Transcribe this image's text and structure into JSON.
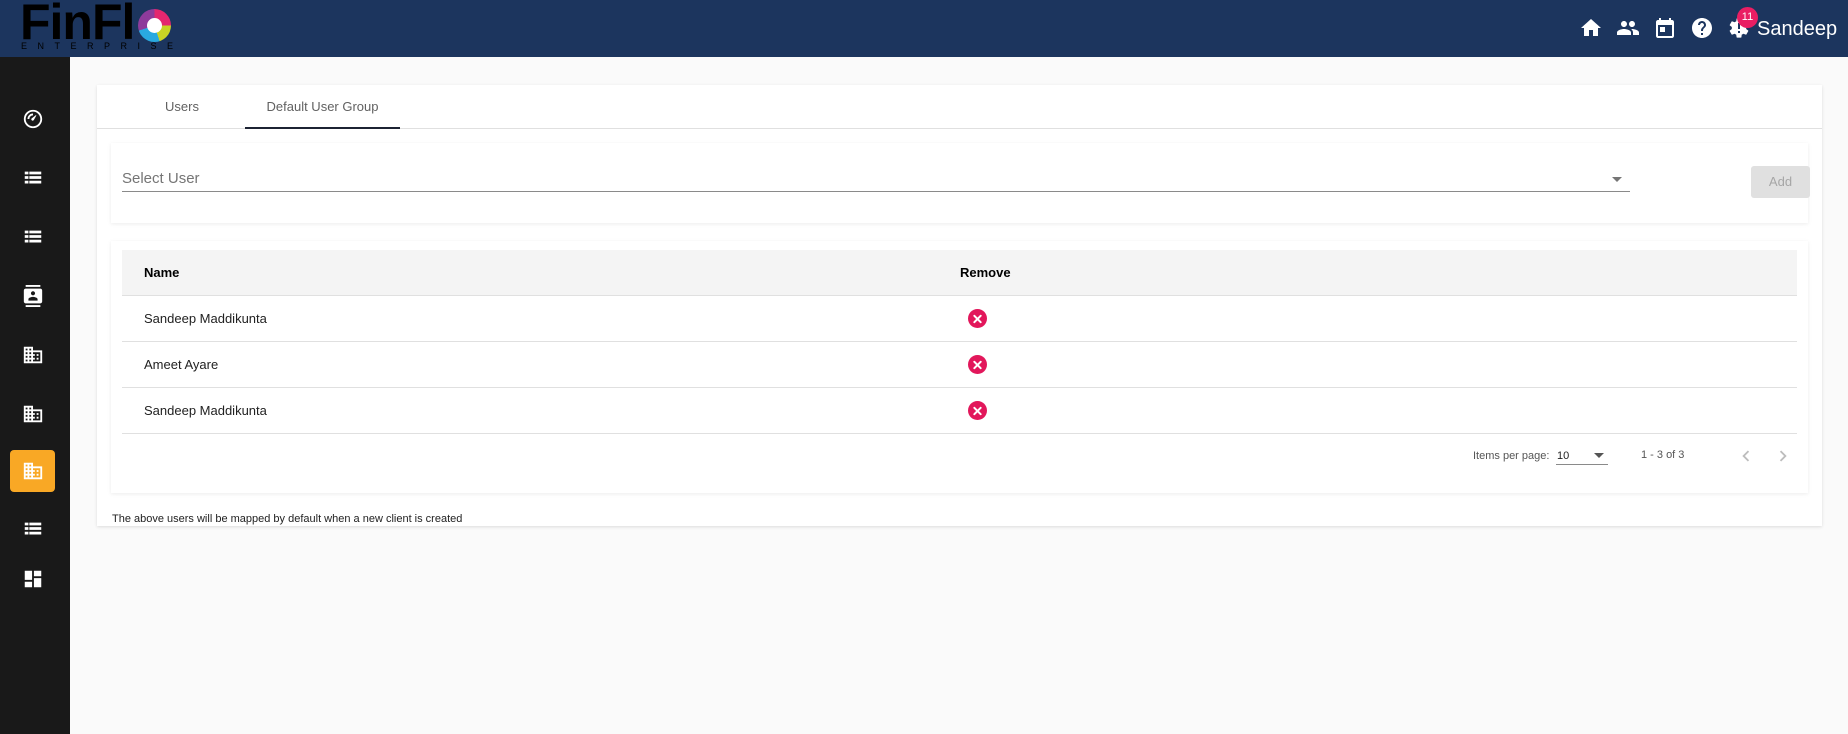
{
  "app": {
    "logo_text": "FinFl",
    "logo_subtext": "ENTERPRISE"
  },
  "header": {
    "notification_count": "11",
    "username": "Sandeep",
    "icons": [
      "home-icon",
      "people-icon",
      "calendar-icon",
      "help-icon",
      "settings-alert-icon"
    ]
  },
  "sidebar": {
    "items": [
      {
        "icon": "speed-icon",
        "active": false
      },
      {
        "icon": "list-icon",
        "active": false
      },
      {
        "icon": "list-icon",
        "active": false
      },
      {
        "icon": "contact-card-icon",
        "active": false
      },
      {
        "icon": "business-icon",
        "active": false
      },
      {
        "icon": "business-icon",
        "active": false
      },
      {
        "icon": "business-icon",
        "active": true
      },
      {
        "icon": "list-icon",
        "active": false
      },
      {
        "icon": "dashboard-icon",
        "active": false
      }
    ],
    "active_color": "#f9a825"
  },
  "tabs": [
    {
      "label": "Users",
      "active": false
    },
    {
      "label": "Default User Group",
      "active": true
    }
  ],
  "select_user": {
    "placeholder": "Select User",
    "add_label": "Add"
  },
  "table": {
    "columns": [
      "Name",
      "Remove"
    ],
    "rows": [
      {
        "name": "Sandeep Maddikunta"
      },
      {
        "name": "Ameet Ayare"
      },
      {
        "name": "Sandeep Maddikunta"
      }
    ]
  },
  "paginator": {
    "items_per_page_label": "Items per page:",
    "page_size": "10",
    "range_label": "1 - 3 of 3"
  },
  "footer_note": "The above users will be mapped by default when a new client is created",
  "colors": {
    "header_bg": "#1c355e",
    "sidebar_bg": "#191919",
    "remove_icon": "#e2175b",
    "badge": "#e91e63"
  }
}
